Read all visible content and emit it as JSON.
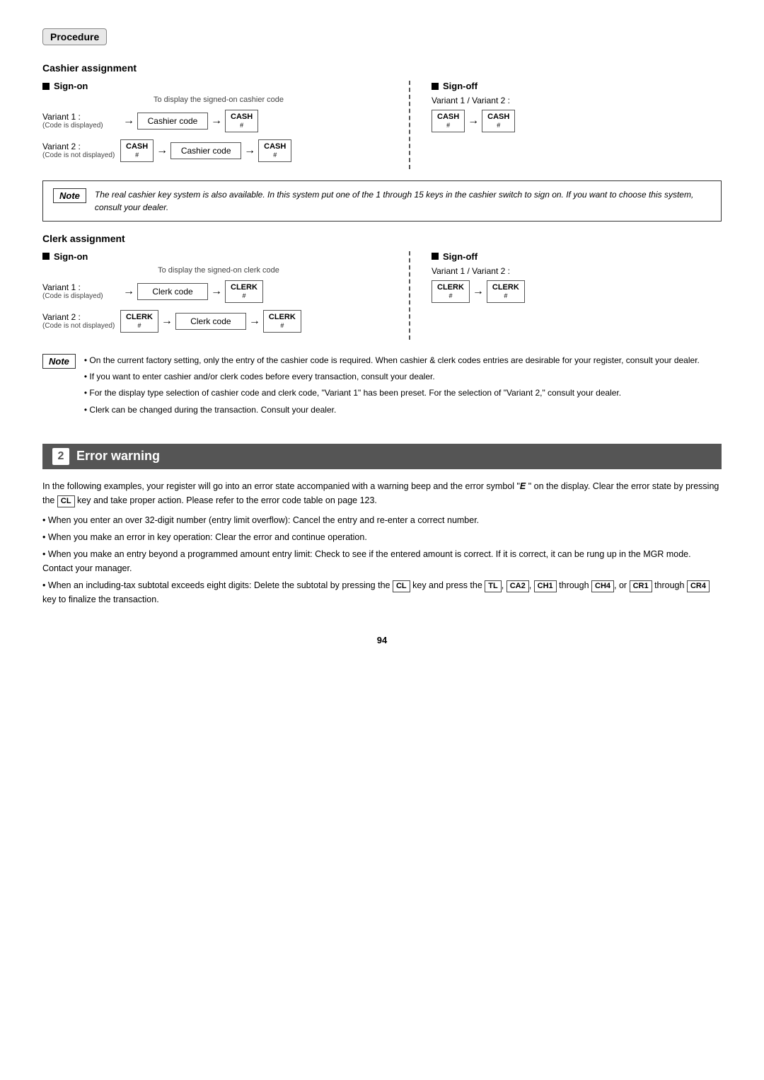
{
  "procedure": {
    "badge": "Procedure"
  },
  "cashier": {
    "header": "Cashier assignment",
    "signon_label": "Sign-on",
    "signoff_label": "Sign-off",
    "display_hint": "To display the signed-on cashier code",
    "variant1_label": "Variant 1 :",
    "variant1_sub": "(Code is displayed)",
    "variant2_label": "Variant 2 :",
    "variant2_sub": "(Code is not displayed)",
    "cashier_code_box": "Cashier code",
    "cash_key_main": "CASH",
    "cash_key_sub": "#",
    "signoff_variant": "Variant 1 / Variant 2 :",
    "note_label": "Note",
    "note_text": "The real cashier key system is also available. In this system put one of the 1 through 15 keys in the cashier switch to sign on. If you want to choose this system, consult your dealer."
  },
  "clerk": {
    "header": "Clerk assignment",
    "signon_label": "Sign-on",
    "signoff_label": "Sign-off",
    "display_hint": "To display the signed-on clerk code",
    "variant1_label": "Variant 1 :",
    "variant1_sub": "(Code is displayed)",
    "variant2_label": "Variant 2 :",
    "variant2_sub": "(Code is not displayed)",
    "clerk_code_box": "Clerk code",
    "clerk_key_main": "CLERK",
    "clerk_key_sub": "#",
    "signoff_variant": "Variant 1 / Variant 2 :",
    "note_label": "Note",
    "note_lines": [
      "• On the current factory setting, only the entry of the cashier code is required. When cashier & clerk codes entries are desirable for your register, consult your dealer.",
      "• If you want to enter cashier and/or clerk codes before every transaction, consult your dealer.",
      "• For the display type selection of cashier code and clerk code, \"Variant 1\" has been preset. For the selection of \"Variant 2,\" consult your dealer.",
      "• Clerk can be changed during the transaction. Consult your dealer."
    ]
  },
  "error_warning": {
    "number": "2",
    "title": "Error warning",
    "intro": "In the following examples, your register will go into an error state accompanied with a warning beep and the error symbol \"",
    "error_symbol": "E",
    "intro2": " \" on the display.  Clear the error state by pressing the",
    "cl_key": "CL",
    "intro3": " key and take proper action. Please refer to the error code table on page 123.",
    "bullets": [
      "• When you enter an over 32-digit number (entry limit overflow): Cancel the entry and re-enter a correct number.",
      "• When you make an error in key operation: Clear the error and continue operation.",
      "• When you make an entry beyond a programmed amount entry limit: Check to see if the entered amount is correct.  If it is correct, it can be rung up in the MGR mode.  Contact your manager.",
      "• When an including-tax subtotal exceeds eight digits: Delete the subtotal by pressing the"
    ],
    "last_bullet_keys": [
      "CL",
      "TL",
      "CA2",
      "CH1",
      "CH4",
      "CR1",
      "CR4"
    ],
    "last_bullet_end": " key to finalize the transaction.",
    "last_bullet_mid": " key and press the",
    "last_bullet_through1": " through ",
    "last_bullet_or": ", or ",
    "last_bullet_through2": " through "
  },
  "page_number": "94"
}
